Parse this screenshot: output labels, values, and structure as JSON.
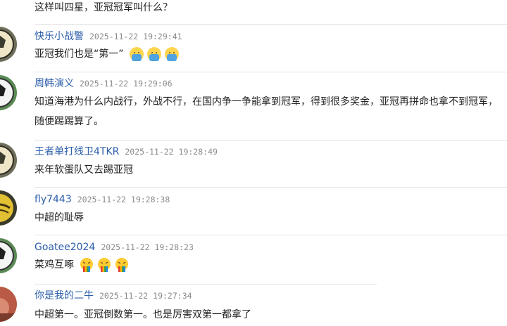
{
  "top_message": "这样叫四星，亚冠冠军叫什么？",
  "comments": [
    {
      "username": "快乐小战警",
      "time": "2025-11-22 19:29:41",
      "text": "亚冠我们也是“第一”",
      "emoji": [
        "praying-emoji",
        "praying-emoji",
        "praying-emoji"
      ],
      "avatar": "soccer-ball-avatar"
    },
    {
      "username": "周韩演义",
      "time": "2025-11-22 19:29:06",
      "text": "知道海港为什么内战行，外战不行，在国内争一争能拿到冠军，得到很多奖金，亚冠再拼命也拿不到冠军，随便踢踢算了。",
      "avatar": "soccer-ball-avatar"
    },
    {
      "username": "王者单打线卫4TKR",
      "time": "2025-11-22 19:28:49",
      "text": "来年软蛋队又去踢亚冠",
      "avatar": "soccer-ball-avatar"
    },
    {
      "username": "fly7443",
      "time": "2025-11-22 19:28:38",
      "text": "中超的耻辱",
      "avatar": "yellow-ball-avatar"
    },
    {
      "username": "Goatee2024",
      "time": "2025-11-22 19:28:23",
      "text": "菜鸡互啄",
      "emoji": [
        "rainbow-vomit-emoji",
        "rainbow-vomit-emoji",
        "rainbow-vomit-emoji"
      ],
      "avatar": "soccer-ball-avatar"
    },
    {
      "username": "你是我的二牛",
      "time": "2025-11-22 19:27:34",
      "text": "中超第一。亚冠倒数第一。也是厉害双第一都拿了",
      "avatar": "red-photo-avatar"
    }
  ]
}
